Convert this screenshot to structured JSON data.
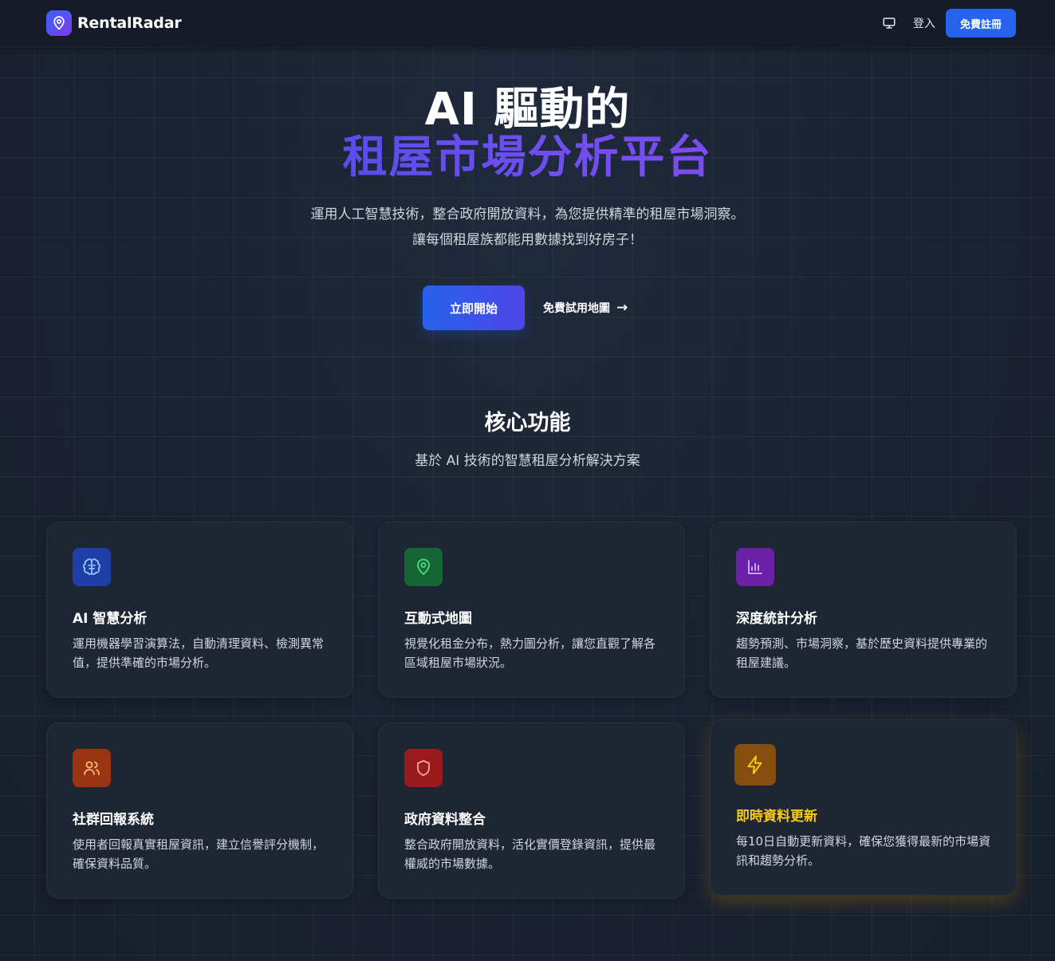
{
  "nav": {
    "brand": "RentalRadar",
    "login_label": "登入",
    "signup_label": "免費註冊"
  },
  "hero": {
    "title_line1": "AI 驅動的",
    "title_line2": "租屋市場分析平台",
    "subtitle_line1": "運用人工智慧技術，整合政府開放資料，為您提供精準的租屋市場洞察。",
    "subtitle_line2": "讓每個租屋族都能用數據找到好房子！",
    "primary_cta": "立即開始",
    "secondary_cta": "免費試用地圖",
    "secondary_arrow": "→"
  },
  "features": {
    "title": "核心功能",
    "subtitle": "基於 AI 技術的智慧租屋分析解決方案",
    "items": [
      {
        "title": "AI 智慧分析",
        "desc": "運用機器學習演算法，自動清理資料、檢測異常值，提供準確的市場分析。",
        "icon": "brain-icon",
        "color": "#1e3fa8"
      },
      {
        "title": "互動式地圖",
        "desc": "視覺化租金分布，熱力圖分析，讓您直觀了解各區域租屋市場狀況。",
        "icon": "map-pin-icon",
        "color": "#166534"
      },
      {
        "title": "深度統計分析",
        "desc": "趨勢預測、市場洞察，基於歷史資料提供專業的租屋建議。",
        "icon": "bar-chart-icon",
        "color": "#6b21a8"
      },
      {
        "title": "社群回報系統",
        "desc": "使用者回報真實租屋資訊，建立信譽評分機制，確保資料品質。",
        "icon": "users-icon",
        "color": "#9a3412"
      },
      {
        "title": "政府資料整合",
        "desc": "整合政府開放資料，活化實價登錄資訊，提供最權威的市場數據。",
        "icon": "shield-icon",
        "color": "#991b1b"
      },
      {
        "title": "即時資料更新",
        "desc": "每10日自動更新資料，確保您獲得最新的市場資訊和趨勢分析。",
        "icon": "lightning-icon",
        "color": "#854d0e"
      }
    ]
  }
}
